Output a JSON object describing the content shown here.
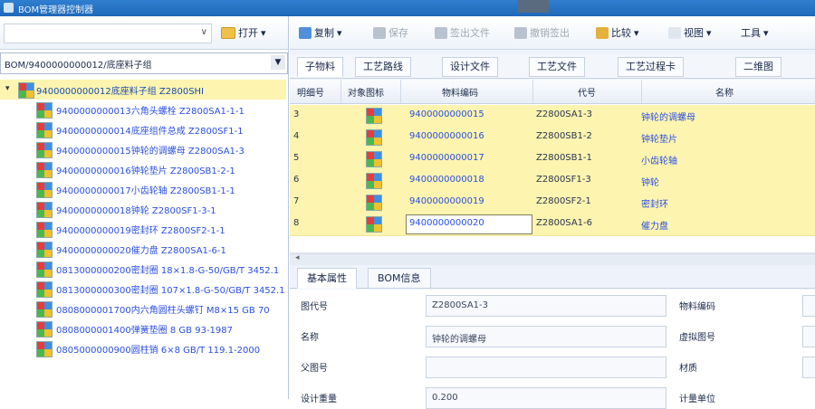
{
  "window": {
    "title": "BOM管理器控制器"
  },
  "left": {
    "filter_value": "",
    "open_button": "打开",
    "path": "BOM/9400000000012/底座料子组",
    "tree": {
      "root": "9400000000012底座料子组 Z2800SHI",
      "children": [
        "9400000000013六角头螺栓 Z2800SA1-1-1",
        "9400000000014底座组件总成 Z2800SF1-1",
        "9400000000015钟轮的调螺母 Z2800SA1-3",
        "9400000000016钟轮垫片 Z2800SB1-2-1",
        "9400000000017小齿轮轴 Z2800SB1-1-1",
        "9400000000018钟轮 Z2800SF1-3-1",
        "9400000000019密封环 Z2800SF2-1-1",
        "9400000000020催力盘 Z2800SA1-6-1",
        "0813000000200密封圈 18×1.8-G-50/GB/T 3452.1",
        "0813000000300密封圈 107×1.8-G-50/GB/T 3452.1",
        "0808000001700内六角圆柱头螺钉 M8×15 GB 70",
        "0808000001400弹簧垫圈 8 GB 93-1987",
        "0805000000900圆柱销 6×8 GB/T 119.1-2000"
      ]
    }
  },
  "toolbar": {
    "copy": "复制",
    "save": "保存",
    "check_out": "签出文件",
    "cancel_check_out": "撤销签出",
    "lifecycle": "比较",
    "view": "视图",
    "tools": "工具"
  },
  "top_tabs": [
    "子物料",
    "工艺路线",
    "设计文件",
    "工艺文件",
    "工艺过程卡",
    "二维图"
  ],
  "grid": {
    "headers": [
      "明细号",
      "对象图标",
      "物料编码",
      "代号",
      "名称"
    ],
    "rows": [
      {
        "seq": "3",
        "code": "9400000000015",
        "drawing": "Z2800SA1-3",
        "name": "钟轮的调螺母"
      },
      {
        "seq": "4",
        "code": "9400000000016",
        "drawing": "Z2800SB1-2",
        "name": "钟轮垫片"
      },
      {
        "seq": "5",
        "code": "9400000000017",
        "drawing": "Z2800SB1-1",
        "name": "小齿轮轴"
      },
      {
        "seq": "6",
        "code": "9400000000018",
        "drawing": "Z2800SF1-3",
        "name": "钟轮"
      },
      {
        "seq": "7",
        "code": "9400000000019",
        "drawing": "Z2800SF2-1",
        "name": "密封环"
      },
      {
        "seq": "8",
        "code": "9400000000020",
        "drawing": "Z2800SA1-6",
        "name": "催力盘"
      }
    ],
    "scroll_left": "◂"
  },
  "bottom_tabs": [
    "基本属性",
    "BOM信息"
  ],
  "form": {
    "drawing_label": "图代号",
    "drawing_value": "Z2800SA1-3",
    "name_label": "名称",
    "name_value": "钟轮的调螺母",
    "parent_label": "父图号",
    "parent_value": "",
    "qty_label": "设计重量",
    "qty_value": "0.200",
    "code_label": "物料编码",
    "version_label": "虚拟图号",
    "material_label": "材质",
    "spec_label": "计量单位"
  }
}
